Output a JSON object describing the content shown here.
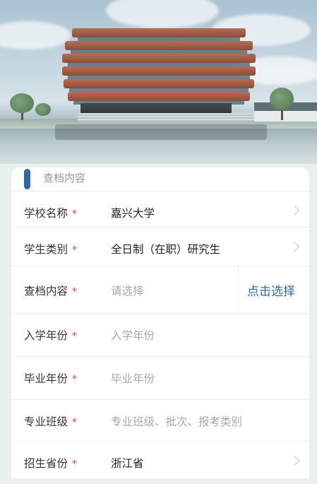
{
  "section": {
    "title": "查档内容"
  },
  "form": {
    "rows": [
      {
        "label": "学校名称",
        "required_mark": "*",
        "value": "嘉兴大学",
        "placeholder": "",
        "action": "chevron-right-icon"
      },
      {
        "label": "学生类别",
        "required_mark": "*",
        "value": "全日制（在职）研究生",
        "placeholder": "",
        "action": "chevron-right-icon"
      },
      {
        "label": "查档内容",
        "required_mark": "*",
        "value": "",
        "placeholder": "请选择",
        "action_label": "点击选择"
      },
      {
        "label": "入学年份",
        "required_mark": "*",
        "value": "",
        "placeholder": "入学年份"
      },
      {
        "label": "毕业年份",
        "required_mark": "*",
        "value": "",
        "placeholder": "毕业年份"
      },
      {
        "label": "专业班级",
        "required_mark": "*",
        "value": "",
        "placeholder": "专业班级、批次、报考类别"
      },
      {
        "label": "招生省份",
        "required_mark": "*",
        "value": "浙江省",
        "placeholder": "",
        "action": "chevron-right-icon"
      }
    ]
  },
  "colors": {
    "accent": "#2f6aa3",
    "required": "#e34242",
    "placeholder": "#a8a8a8",
    "background": "#e8f1ee"
  }
}
